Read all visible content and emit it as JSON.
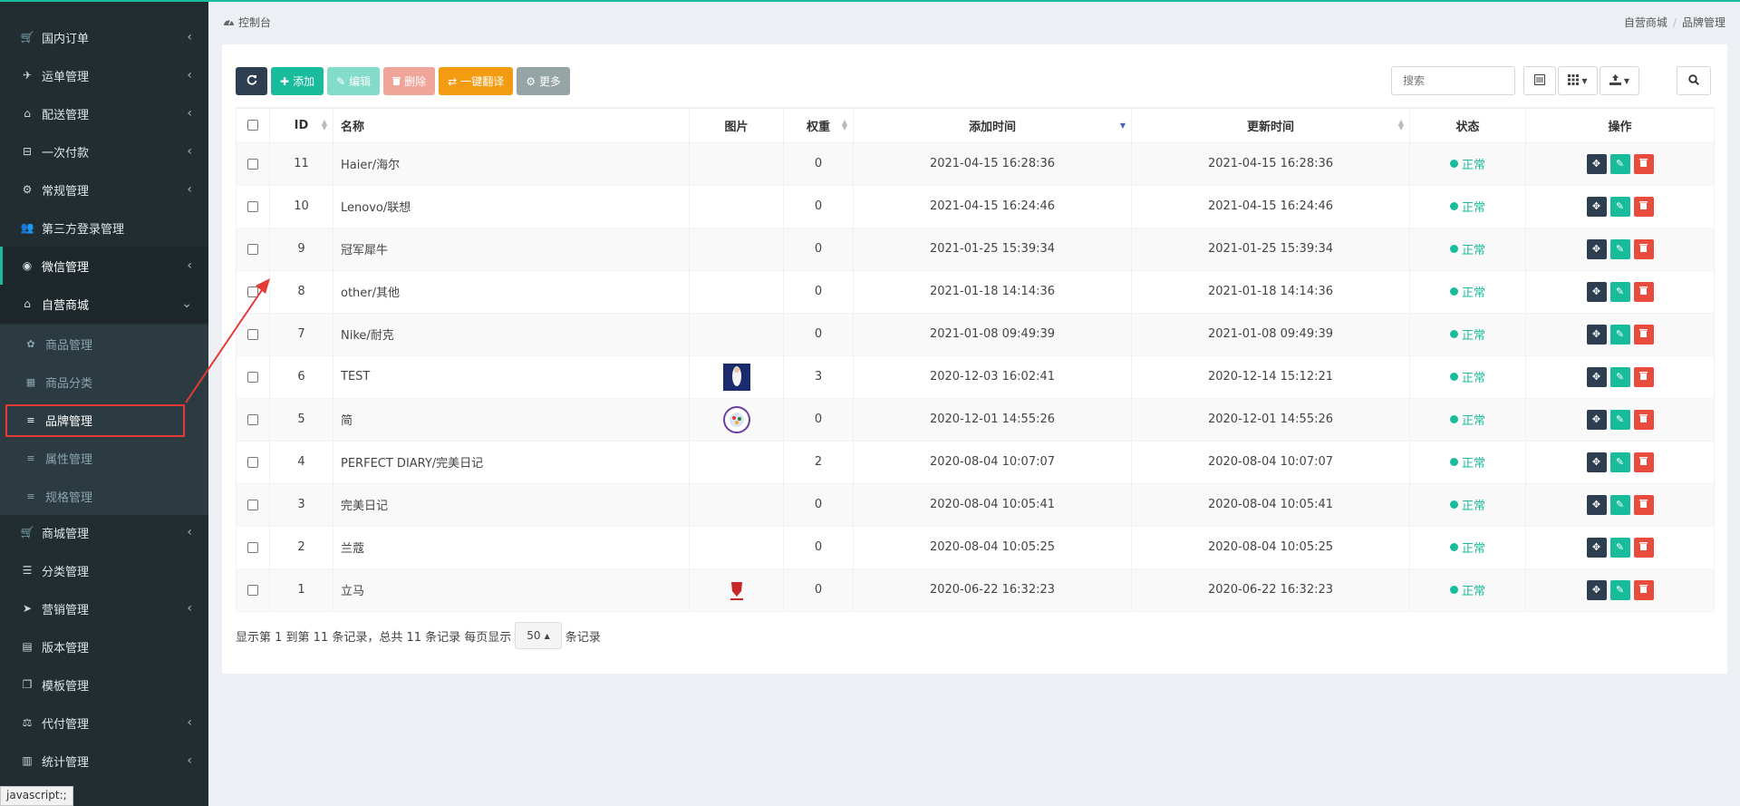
{
  "sidebar": {
    "items": [
      {
        "label": "国内订单",
        "icon": "cart-icon",
        "chevron": "‹"
      },
      {
        "label": "运单管理",
        "icon": "plane-icon",
        "chevron": "‹"
      },
      {
        "label": "配送管理",
        "icon": "bank-icon",
        "chevron": "‹"
      },
      {
        "label": "一次付款",
        "icon": "basket-icon",
        "chevron": "‹"
      },
      {
        "label": "常规管理",
        "icon": "cogs-icon",
        "chevron": "‹"
      },
      {
        "label": "第三方登录管理",
        "icon": "users-icon",
        "chevron": ""
      },
      {
        "label": "微信管理",
        "icon": "wechat-icon",
        "chevron": "‹"
      },
      {
        "label": "自营商城",
        "icon": "store-icon",
        "chevron": "⌄"
      },
      {
        "label": "商城管理",
        "icon": "cart-icon",
        "chevron": "‹"
      },
      {
        "label": "分类管理",
        "icon": "list-icon",
        "chevron": ""
      },
      {
        "label": "营销管理",
        "icon": "send-icon",
        "chevron": "‹"
      },
      {
        "label": "版本管理",
        "icon": "file-icon",
        "chevron": ""
      },
      {
        "label": "模板管理",
        "icon": "clone-icon",
        "chevron": ""
      },
      {
        "label": "代付管理",
        "icon": "balance-icon",
        "chevron": "‹"
      },
      {
        "label": "统计管理",
        "icon": "bar-chart-icon",
        "chevron": "‹"
      }
    ],
    "submenu": [
      {
        "label": "商品管理",
        "icon": "gift-icon"
      },
      {
        "label": "商品分类",
        "icon": "grid-icon"
      },
      {
        "label": "品牌管理",
        "icon": "bars-icon"
      },
      {
        "label": "属性管理",
        "icon": "bars-icon"
      },
      {
        "label": "规格管理",
        "icon": "bars-icon"
      }
    ],
    "status_text": "javascript:;"
  },
  "topbar": {
    "dashboard": "控制台",
    "crumb1": "自营商城",
    "crumb2": "品牌管理"
  },
  "toolbar": {
    "add": "添加",
    "edit": "编辑",
    "delete": "删除",
    "translate": "一键翻译",
    "more": "更多"
  },
  "search": {
    "placeholder": "搜索"
  },
  "table": {
    "headers": {
      "id": "ID",
      "name": "名称",
      "image": "图片",
      "weight": "权重",
      "created": "添加时间",
      "updated": "更新时间",
      "status": "状态",
      "ops": "操作"
    },
    "rows": [
      {
        "id": "11",
        "name": "Haier/海尔",
        "image": "",
        "weight": "0",
        "created": "2021-04-15 16:28:36",
        "updated": "2021-04-15 16:28:36",
        "status": "正常"
      },
      {
        "id": "10",
        "name": "Lenovo/联想",
        "image": "",
        "weight": "0",
        "created": "2021-04-15 16:24:46",
        "updated": "2021-04-15 16:24:46",
        "status": "正常"
      },
      {
        "id": "9",
        "name": "冠军犀牛",
        "image": "",
        "weight": "0",
        "created": "2021-01-25 15:39:34",
        "updated": "2021-01-25 15:39:34",
        "status": "正常"
      },
      {
        "id": "8",
        "name": "other/其他",
        "image": "",
        "weight": "0",
        "created": "2021-01-18 14:14:36",
        "updated": "2021-01-18 14:14:36",
        "status": "正常"
      },
      {
        "id": "7",
        "name": "Nike/耐克",
        "image": "",
        "weight": "0",
        "created": "2021-01-08 09:49:39",
        "updated": "2021-01-08 09:49:39",
        "status": "正常"
      },
      {
        "id": "6",
        "name": "TEST",
        "image": "figure",
        "weight": "3",
        "created": "2020-12-03 16:02:41",
        "updated": "2020-12-14 15:12:21",
        "status": "正常"
      },
      {
        "id": "5",
        "name": "简",
        "image": "badge",
        "weight": "0",
        "created": "2020-12-01 14:55:26",
        "updated": "2020-12-01 14:55:26",
        "status": "正常"
      },
      {
        "id": "4",
        "name": "PERFECT DIARY/完美日记",
        "image": "",
        "weight": "2",
        "created": "2020-08-04 10:07:07",
        "updated": "2020-08-04 10:07:07",
        "status": "正常"
      },
      {
        "id": "3",
        "name": "完美日记",
        "image": "",
        "weight": "0",
        "created": "2020-08-04 10:05:41",
        "updated": "2020-08-04 10:05:41",
        "status": "正常"
      },
      {
        "id": "2",
        "name": "兰蔻",
        "image": "",
        "weight": "0",
        "created": "2020-08-04 10:05:25",
        "updated": "2020-08-04 10:05:25",
        "status": "正常"
      },
      {
        "id": "1",
        "name": "立马",
        "image": "logo",
        "weight": "0",
        "created": "2020-06-22 16:32:23",
        "updated": "2020-06-22 16:32:23",
        "status": "正常"
      }
    ]
  },
  "pager": {
    "summary": "显示第 1 到第 11 条记录，总共 11 条记录 每页显示",
    "page_size": "50",
    "suffix": "条记录"
  },
  "colors": {
    "accent": "#18bc9c",
    "sidebar_bg": "#222d32",
    "danger": "#e74c3c",
    "warning": "#f39c12",
    "annotation": "#e53935"
  }
}
